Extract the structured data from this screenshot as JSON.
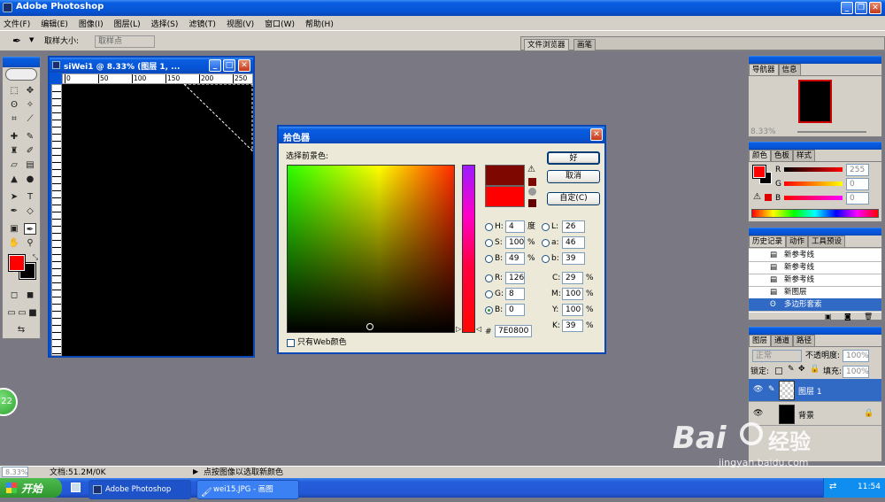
{
  "app": {
    "title": "Adobe Photoshop"
  },
  "menu": [
    "文件(F)",
    "编辑(E)",
    "图像(I)",
    "图层(L)",
    "选择(S)",
    "滤镜(T)",
    "视图(V)",
    "窗口(W)",
    "帮助(H)"
  ],
  "options": {
    "sample_size_label": "取样大小:",
    "sample_size_value": "取样点",
    "browser_tabs": [
      "文件浏览器",
      "画笔"
    ]
  },
  "document": {
    "title": "siWei1 @ 8.33% (图层 1, ...",
    "ruler_ticks": [
      "0",
      "50",
      "100",
      "150",
      "200",
      "250"
    ]
  },
  "dialog": {
    "title": "拾色器",
    "prompt": "选择前景色:",
    "ok": "好",
    "cancel": "取消",
    "custom": "自定(C)",
    "h": {
      "label": "H:",
      "value": "4",
      "unit": "度"
    },
    "s": {
      "label": "S:",
      "value": "100",
      "unit": "%"
    },
    "b": {
      "label": "B:",
      "value": "49",
      "unit": "%"
    },
    "r": {
      "label": "R:",
      "value": "126"
    },
    "g": {
      "label": "G:",
      "value": "8"
    },
    "bb": {
      "label": "B:",
      "value": "0"
    },
    "l": {
      "label": "L:",
      "value": "26"
    },
    "a": {
      "label": "a:",
      "value": "46"
    },
    "b2": {
      "label": "b:",
      "value": "39"
    },
    "c": {
      "label": "C:",
      "value": "29",
      "unit": "%"
    },
    "m": {
      "label": "M:",
      "value": "100",
      "unit": "%"
    },
    "y": {
      "label": "Y:",
      "value": "100",
      "unit": "%"
    },
    "k": {
      "label": "K:",
      "value": "39",
      "unit": "%"
    },
    "hex_label": "#",
    "hex": "7E0800",
    "web_only": "只有Web颜色",
    "new_color": "#7e0800",
    "old_color": "#ff0000"
  },
  "navigator": {
    "tabs": [
      "导航器",
      "信息"
    ],
    "zoom": "8.33%"
  },
  "color_panel": {
    "tabs": [
      "颜色",
      "色板",
      "样式"
    ],
    "r_label": "R",
    "g_label": "G",
    "b_label": "B",
    "r": "255",
    "g": "0",
    "b": "0"
  },
  "history": {
    "tabs": [
      "历史记录",
      "动作",
      "工具预设"
    ],
    "items": [
      "新参考线",
      "新参考线",
      "新参考线",
      "新图层",
      "多边形套索"
    ]
  },
  "layers": {
    "tabs": [
      "图层",
      "通道",
      "路径"
    ],
    "mode": "正常",
    "opacity_label": "不透明度:",
    "opacity": "100%",
    "lock_label": "锁定:",
    "fill_label": "填充:",
    "fill": "100%",
    "items": [
      "图层 1",
      "背景"
    ]
  },
  "status": {
    "zoom": "8.33%",
    "doc": "文档:51.2M/0K",
    "hint": "点按图像以选取新颜色"
  },
  "taskbar": {
    "start": "开始",
    "tasks": [
      "Adobe Photoshop",
      "wei15.JPG - 画图"
    ],
    "clock": "11:54"
  },
  "float_badge": "22",
  "watermark": {
    "brand": "Bai",
    "brand2": "经验",
    "url": "jingyan.baidu.com"
  },
  "colors": {
    "foreground": "#ff0000",
    "background": "#000000",
    "accent": "#0a5de0"
  }
}
